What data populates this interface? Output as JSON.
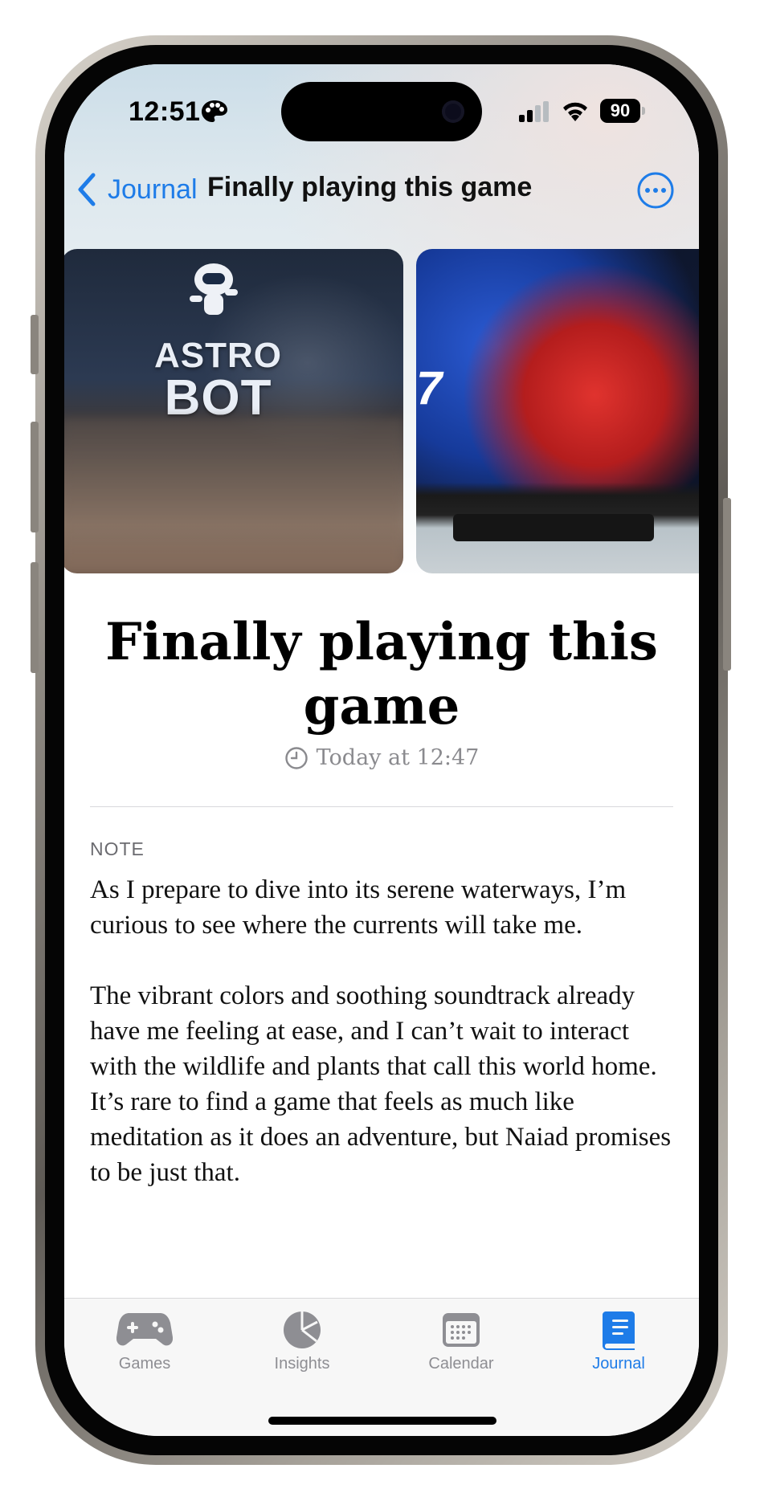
{
  "status_bar": {
    "time": "12:51",
    "battery": "90",
    "icons": [
      "palette-icon",
      "cellular-signal-icon",
      "wifi-icon",
      "battery-icon"
    ]
  },
  "nav": {
    "back_label": "Journal",
    "title": "Finally playing this game",
    "more_icon": "ellipsis-circle-icon"
  },
  "photos": [
    {
      "caption_top": "ASTRO",
      "caption_bottom": "BOT"
    },
    {
      "overlay_text": "7"
    }
  ],
  "entry": {
    "title": "Finally playing this game",
    "date": "Today at 12:47"
  },
  "note": {
    "heading": "NOTE",
    "paragraphs": [
      "As I prepare to dive into its serene waterways, I’m curious to see where the currents will take me.",
      "The vibrant colors and soothing soundtrack already have me feeling at ease, and I can’t wait to interact with the wildlife and plants that call this world home. It’s rare to find a game that feels as much like meditation as it does an adventure, but Naiad promises to be just that."
    ]
  },
  "tabs": [
    {
      "label": "Games",
      "icon": "gamecontroller-icon",
      "active": false
    },
    {
      "label": "Insights",
      "icon": "pie-chart-icon",
      "active": false
    },
    {
      "label": "Calendar",
      "icon": "calendar-icon",
      "active": false
    },
    {
      "label": "Journal",
      "icon": "book-icon",
      "active": true
    }
  ],
  "colors": {
    "accent": "#1e7ce8",
    "inactive": "#8e8e93",
    "text": "#111111"
  }
}
